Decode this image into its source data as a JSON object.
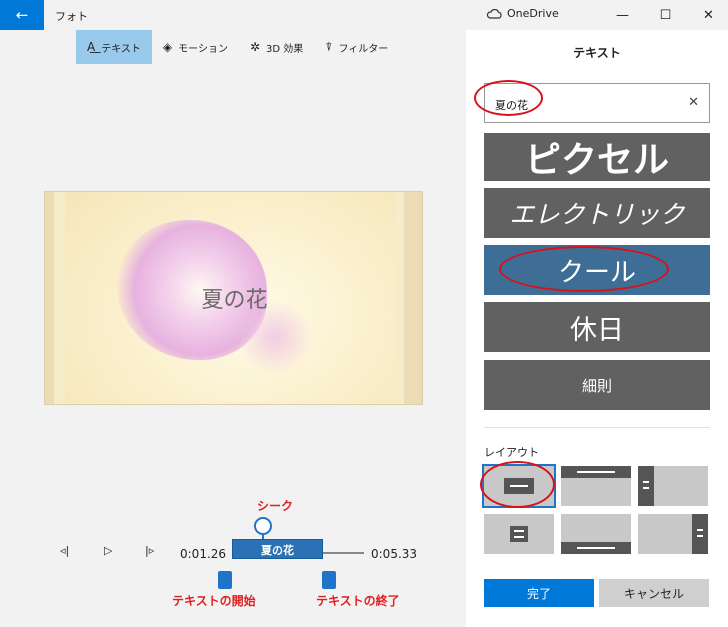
{
  "window": {
    "app_title": "フォト",
    "onedrive_label": "OneDrive",
    "back_icon": "back-arrow-icon",
    "minimize_glyph": "—",
    "maximize_glyph": "☐",
    "close_glyph": "✕"
  },
  "toolbar": {
    "items": [
      {
        "label": "テキスト",
        "icon": "text-icon",
        "glyph": "A͟",
        "active": true
      },
      {
        "label": "モーション",
        "icon": "motion-icon",
        "glyph": "◈"
      },
      {
        "label": "3D 効果",
        "icon": "3d-effects-icon",
        "glyph": "✲"
      },
      {
        "label": "フィルター",
        "icon": "filter-icon",
        "glyph": "⍒"
      }
    ]
  },
  "preview": {
    "overlay_text": "夏の花"
  },
  "playback": {
    "current_time": "0:01.26",
    "end_time": "0:05.33",
    "clip_label": "夏の花",
    "prev_glyph": "◃|",
    "play_glyph": "▷",
    "next_glyph": "|▹"
  },
  "annotations": {
    "seek": "シーク",
    "text_start": "テキストの開始",
    "text_end": "テキストの終了"
  },
  "panel": {
    "title": "テキスト",
    "search_value": "夏の花",
    "clear_glyph": "✕",
    "styles": [
      "ピクセル",
      "エレクトリック",
      "クール",
      "休日",
      "細則"
    ],
    "selected_style": "クール",
    "layout_label": "レイアウト",
    "done_label": "完了",
    "cancel_label": "キャンセル"
  },
  "colors": {
    "accent": "#0078d7",
    "selected_style": "#3e6d95",
    "style_card": "#616161",
    "annotation": "#e0201f"
  }
}
